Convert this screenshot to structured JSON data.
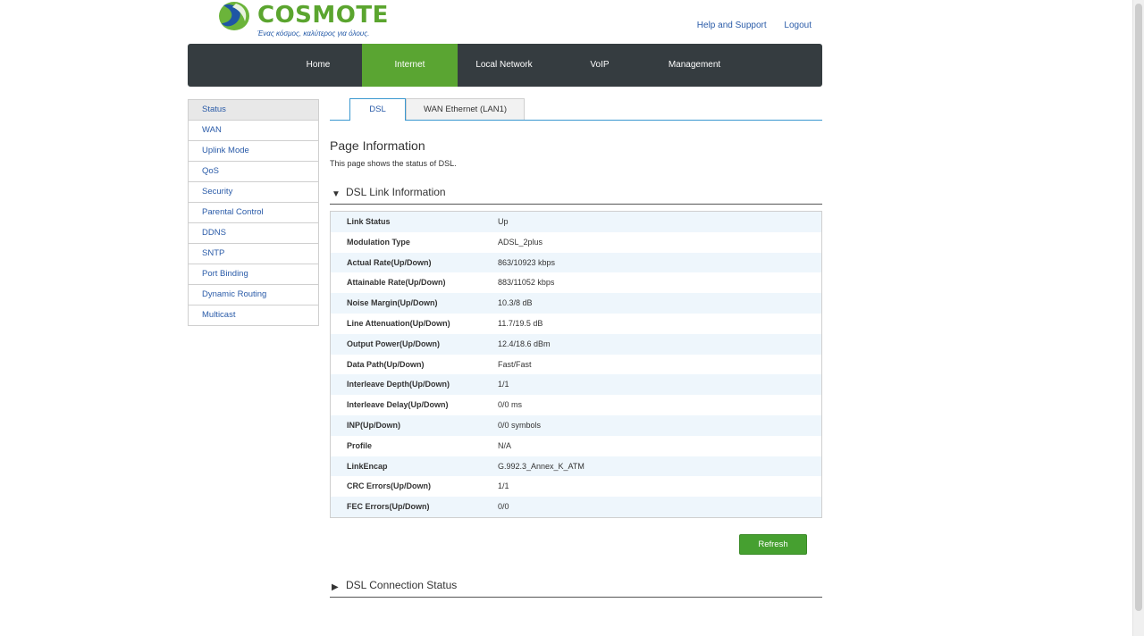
{
  "brand": {
    "name": "COSMOTE",
    "tagline": "Ένας κόσμος, καλύτερος για όλους.",
    "green": "#5ba52f",
    "blue": "#1f56a5"
  },
  "header_links": {
    "help": "Help and Support",
    "logout": "Logout"
  },
  "nav": {
    "items": [
      "Home",
      "Internet",
      "Local Network",
      "VoIP",
      "Management"
    ],
    "active": "Internet"
  },
  "sidebar": {
    "items": [
      "Status",
      "WAN",
      "Uplink Mode",
      "QoS",
      "Security",
      "Parental Control",
      "DDNS",
      "SNTP",
      "Port Binding",
      "Dynamic Routing",
      "Multicast"
    ],
    "active": "Status"
  },
  "tabs": {
    "items": [
      "DSL",
      "WAN Ethernet (LAN1)"
    ],
    "active": "DSL"
  },
  "page": {
    "title": "Page Information",
    "description": "This page shows the status of DSL."
  },
  "sections": {
    "link_info": "DSL Link Information",
    "connection_status": "DSL Connection Status"
  },
  "link_info_rows": [
    {
      "label": "Link Status",
      "value": "Up"
    },
    {
      "label": "Modulation Type",
      "value": "ADSL_2plus"
    },
    {
      "label": "Actual Rate(Up/Down)",
      "value": "863/10923 kbps"
    },
    {
      "label": "Attainable Rate(Up/Down)",
      "value": "883/11052 kbps"
    },
    {
      "label": "Noise Margin(Up/Down)",
      "value": "10.3/8 dB"
    },
    {
      "label": "Line Attenuation(Up/Down)",
      "value": "11.7/19.5 dB"
    },
    {
      "label": "Output Power(Up/Down)",
      "value": "12.4/18.6 dBm"
    },
    {
      "label": "Data Path(Up/Down)",
      "value": "Fast/Fast"
    },
    {
      "label": "Interleave Depth(Up/Down)",
      "value": "1/1"
    },
    {
      "label": "Interleave Delay(Up/Down)",
      "value": "0/0 ms"
    },
    {
      "label": "INP(Up/Down)",
      "value": "0/0 symbols"
    },
    {
      "label": "Profile",
      "value": "N/A"
    },
    {
      "label": "LinkEncap",
      "value": "G.992.3_Annex_K_ATM"
    },
    {
      "label": "CRC Errors(Up/Down)",
      "value": "1/1"
    },
    {
      "label": "FEC Errors(Up/Down)",
      "value": "0/0"
    }
  ],
  "buttons": {
    "refresh": "Refresh"
  },
  "icons": {
    "expanded": "triangle-down-icon",
    "collapsed": "triangle-right-icon"
  }
}
